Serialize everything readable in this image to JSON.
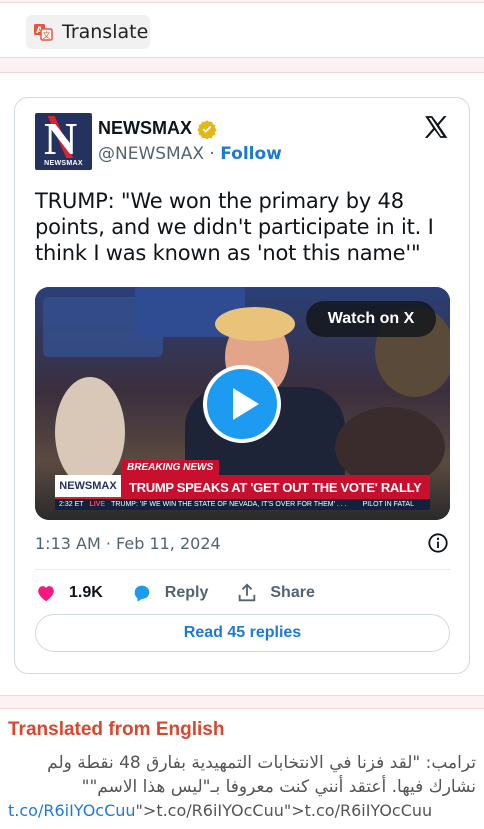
{
  "toolbar": {
    "translate_label": "Translate",
    "translate_icon": "translate-icon"
  },
  "tweet": {
    "author_name": "NEWSMAX",
    "handle": "@NEWSMAX",
    "separator": "·",
    "follow_label": "Follow",
    "avatar_letter": "N",
    "avatar_sub": "NEWSMAX",
    "text": "TRUMP: \"We won the primary by 48 points, and we didn't participate in it. I think I was known as 'not this name'\"",
    "video": {
      "watch_label": "Watch on X",
      "breaking": "BREAKING NEWS",
      "channel": "NEWSMAX",
      "headline": "TRUMP SPEAKS AT 'GET OUT THE VOTE' RALLY",
      "ticker_time": "2:32 ET",
      "ticker_live": "LIVE",
      "ticker_text": "TRUMP: 'IF WE WIN THE STATE OF NEVADA, IT'S OVER FOR THEM' . . .",
      "ticker_right": "PILOT IN FATAL"
    },
    "timestamp": "1:13 AM · Feb 11, 2024",
    "likes": "1.9K",
    "reply_label": "Reply",
    "share_label": "Share",
    "read_replies_label": "Read 45 replies"
  },
  "translation": {
    "title": "Translated from English",
    "body": "ترامب: \"لقد فزنا في الانتخابات التمهيدية بفارق 48 نقطة ولم نشارك فيها. أعتقد أنني كنت معروفا بـ\"ليس هذا الاسم\"\"",
    "link_text": "t.co/R6iIYOcCuu",
    "link_suffix": "\">t.co/R6iIYOcCuu\">t.co/R6iIYOcCuu"
  },
  "colors": {
    "accent": "#1d7ad4",
    "like": "#f91880",
    "translation_title": "#d9472e",
    "brand": "#23325f"
  }
}
